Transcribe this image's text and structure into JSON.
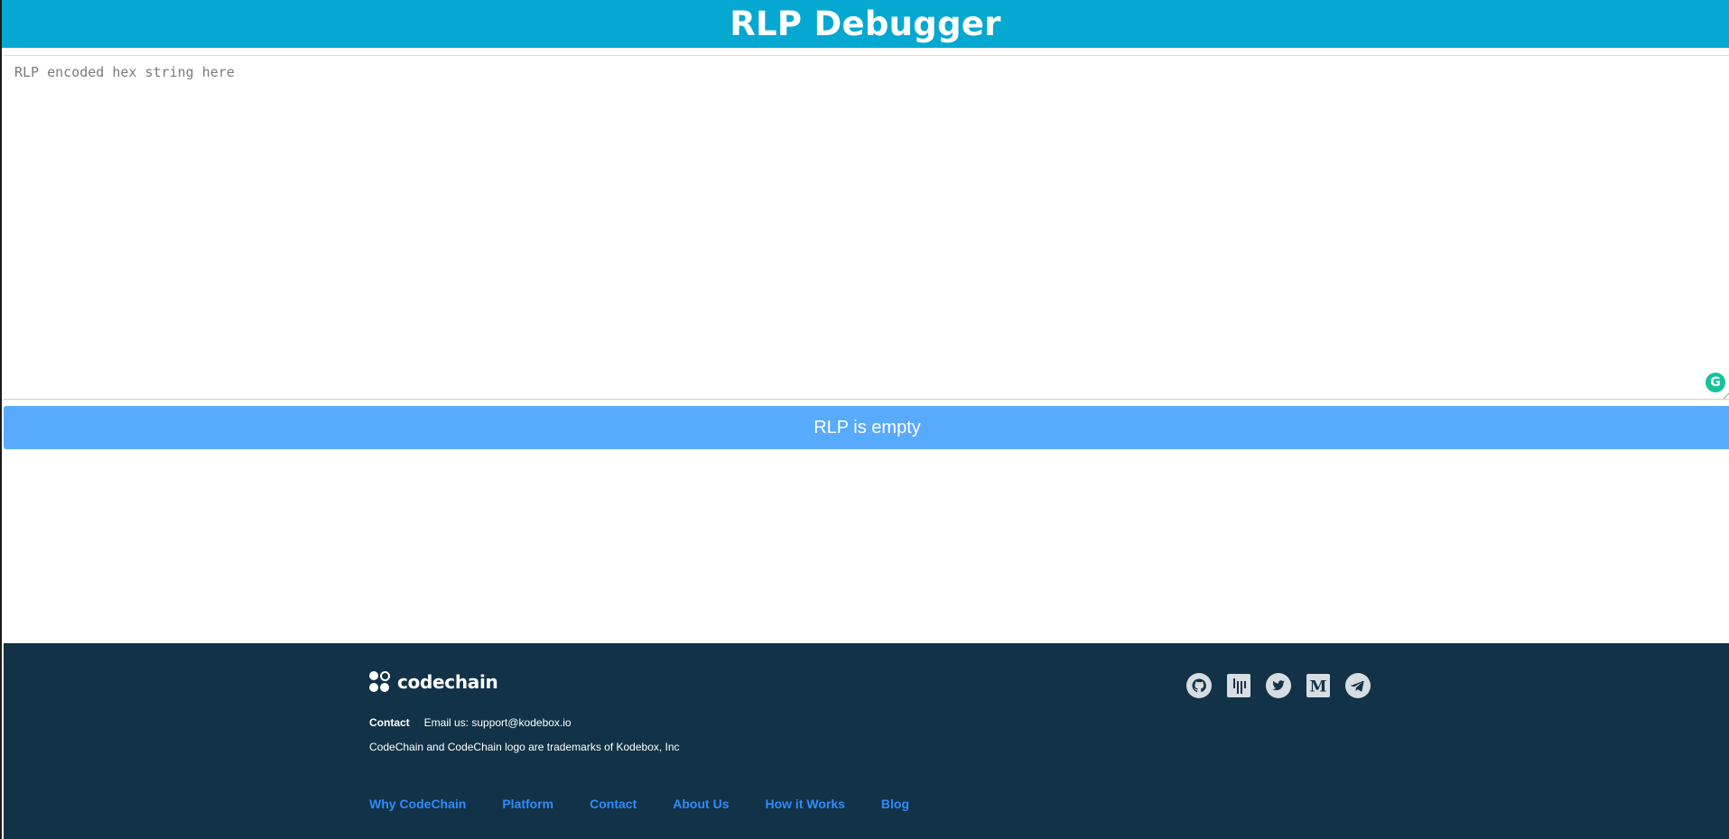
{
  "header": {
    "title": "RLP Debugger"
  },
  "editor": {
    "placeholder": "RLP encoded hex string here",
    "value": ""
  },
  "status": {
    "text": "RLP is empty"
  },
  "footer": {
    "logo_text": "codechain",
    "contact_label": "Contact",
    "contact_email": "Email us: support@kodebox.io",
    "trademark": "CodeChain and CodeChain logo are trademarks of Kodebox, Inc",
    "nav": [
      {
        "label": "Why CodeChain"
      },
      {
        "label": "Platform"
      },
      {
        "label": "Contact"
      },
      {
        "label": "About Us"
      },
      {
        "label": "How it Works"
      },
      {
        "label": "Blog"
      }
    ],
    "social_icons": [
      "github-icon",
      "gitter-icon",
      "twitter-icon",
      "medium-icon",
      "telegram-icon"
    ]
  },
  "colors": {
    "header_bg": "#05a8d1",
    "status_bg": "#58aafc",
    "footer_bg": "#123247",
    "footer_link": "#2f8bfd"
  }
}
